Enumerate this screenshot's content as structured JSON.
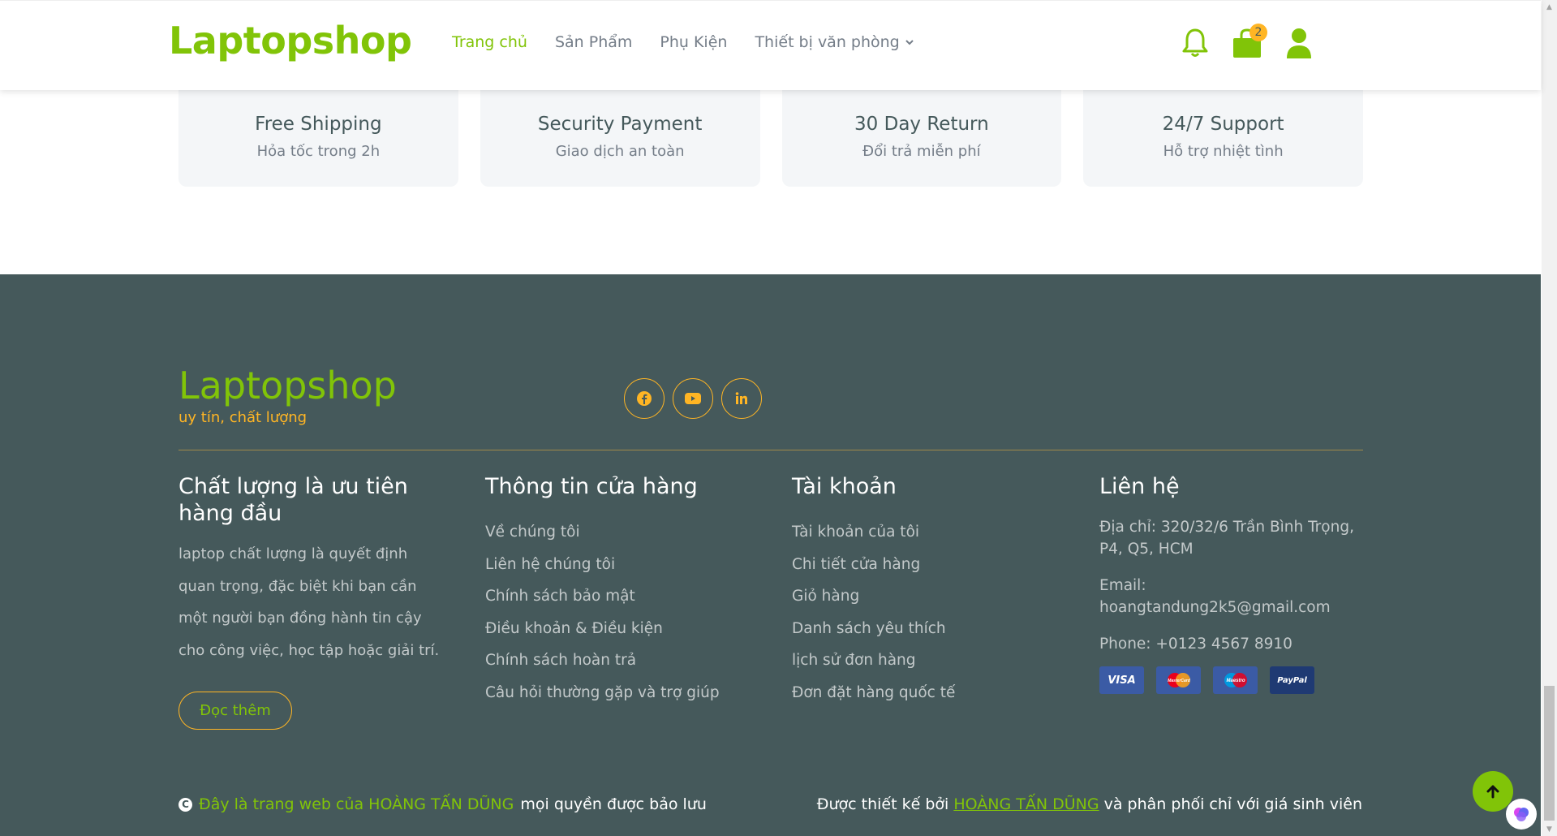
{
  "header": {
    "logo": "Laptopshop",
    "nav": {
      "home": "Trang chủ",
      "products": "Sản Phẩm",
      "accessories": "Phụ Kiện",
      "office": "Thiết bị văn phòng"
    },
    "cart_count": "2"
  },
  "features": [
    {
      "title": "Free Shipping",
      "subtitle": "Hỏa tốc trong 2h"
    },
    {
      "title": "Security Payment",
      "subtitle": "Giao dịch an toàn"
    },
    {
      "title": "30 Day Return",
      "subtitle": "Đổi trả miễn phí"
    },
    {
      "title": "24/7 Support",
      "subtitle": "Hỗ trợ nhiệt tình"
    }
  ],
  "footer": {
    "logo": "Laptopshop",
    "slogan": "uy tín, chất lượng",
    "col1": {
      "heading": "Chất lượng là ưu tiên hàng đầu",
      "desc": "laptop chất lượng là quyết định quan trọng, đặc biệt khi bạn cần một người bạn đồng hành tin cậy cho công việc, học tập hoặc giải trí.",
      "button": "Đọc thêm"
    },
    "col2": {
      "heading": "Thông tin cửa hàng",
      "links": [
        "Về chúng tôi",
        "Liên hệ chúng tôi",
        "Chính sách bảo mật",
        "Điều khoản & Điều kiện",
        "Chính sách hoàn trả",
        "Câu hỏi thường gặp và trợ giúp"
      ]
    },
    "col3": {
      "heading": "Tài khoản",
      "links": [
        "Tài khoản của tôi",
        "Chi tiết cửa hàng",
        "Giỏ hàng",
        "Danh sách yêu thích",
        "lịch sử đơn hàng",
        "Đơn đặt hàng quốc tế"
      ]
    },
    "col4": {
      "heading": "Liên hệ",
      "address": "Địa chỉ: 320/32/6 Trần Bình Trọng, P4, Q5, HCM",
      "email": "Email: hoangtandung2k5@gmail.com",
      "phone": "Phone: +0123 4567 8910",
      "cards": [
        "VISA",
        "MasterCard",
        "Maestro",
        "PayPal"
      ]
    },
    "copyright": {
      "symbol": "C",
      "owner_text": "Đây là trang web của HOÀNG TẤN DŨNG",
      "rights": "mọi quyền được bảo lưu"
    },
    "designed": {
      "prefix": "Được thiết kế bởi",
      "name": "HOÀNG TẤN DŨNG",
      "suffix": "và phân phối chỉ với giá sinh viên"
    }
  },
  "colors": {
    "brand": "#81c408",
    "accent": "#ffb524",
    "footer_bg": "#45595b"
  }
}
